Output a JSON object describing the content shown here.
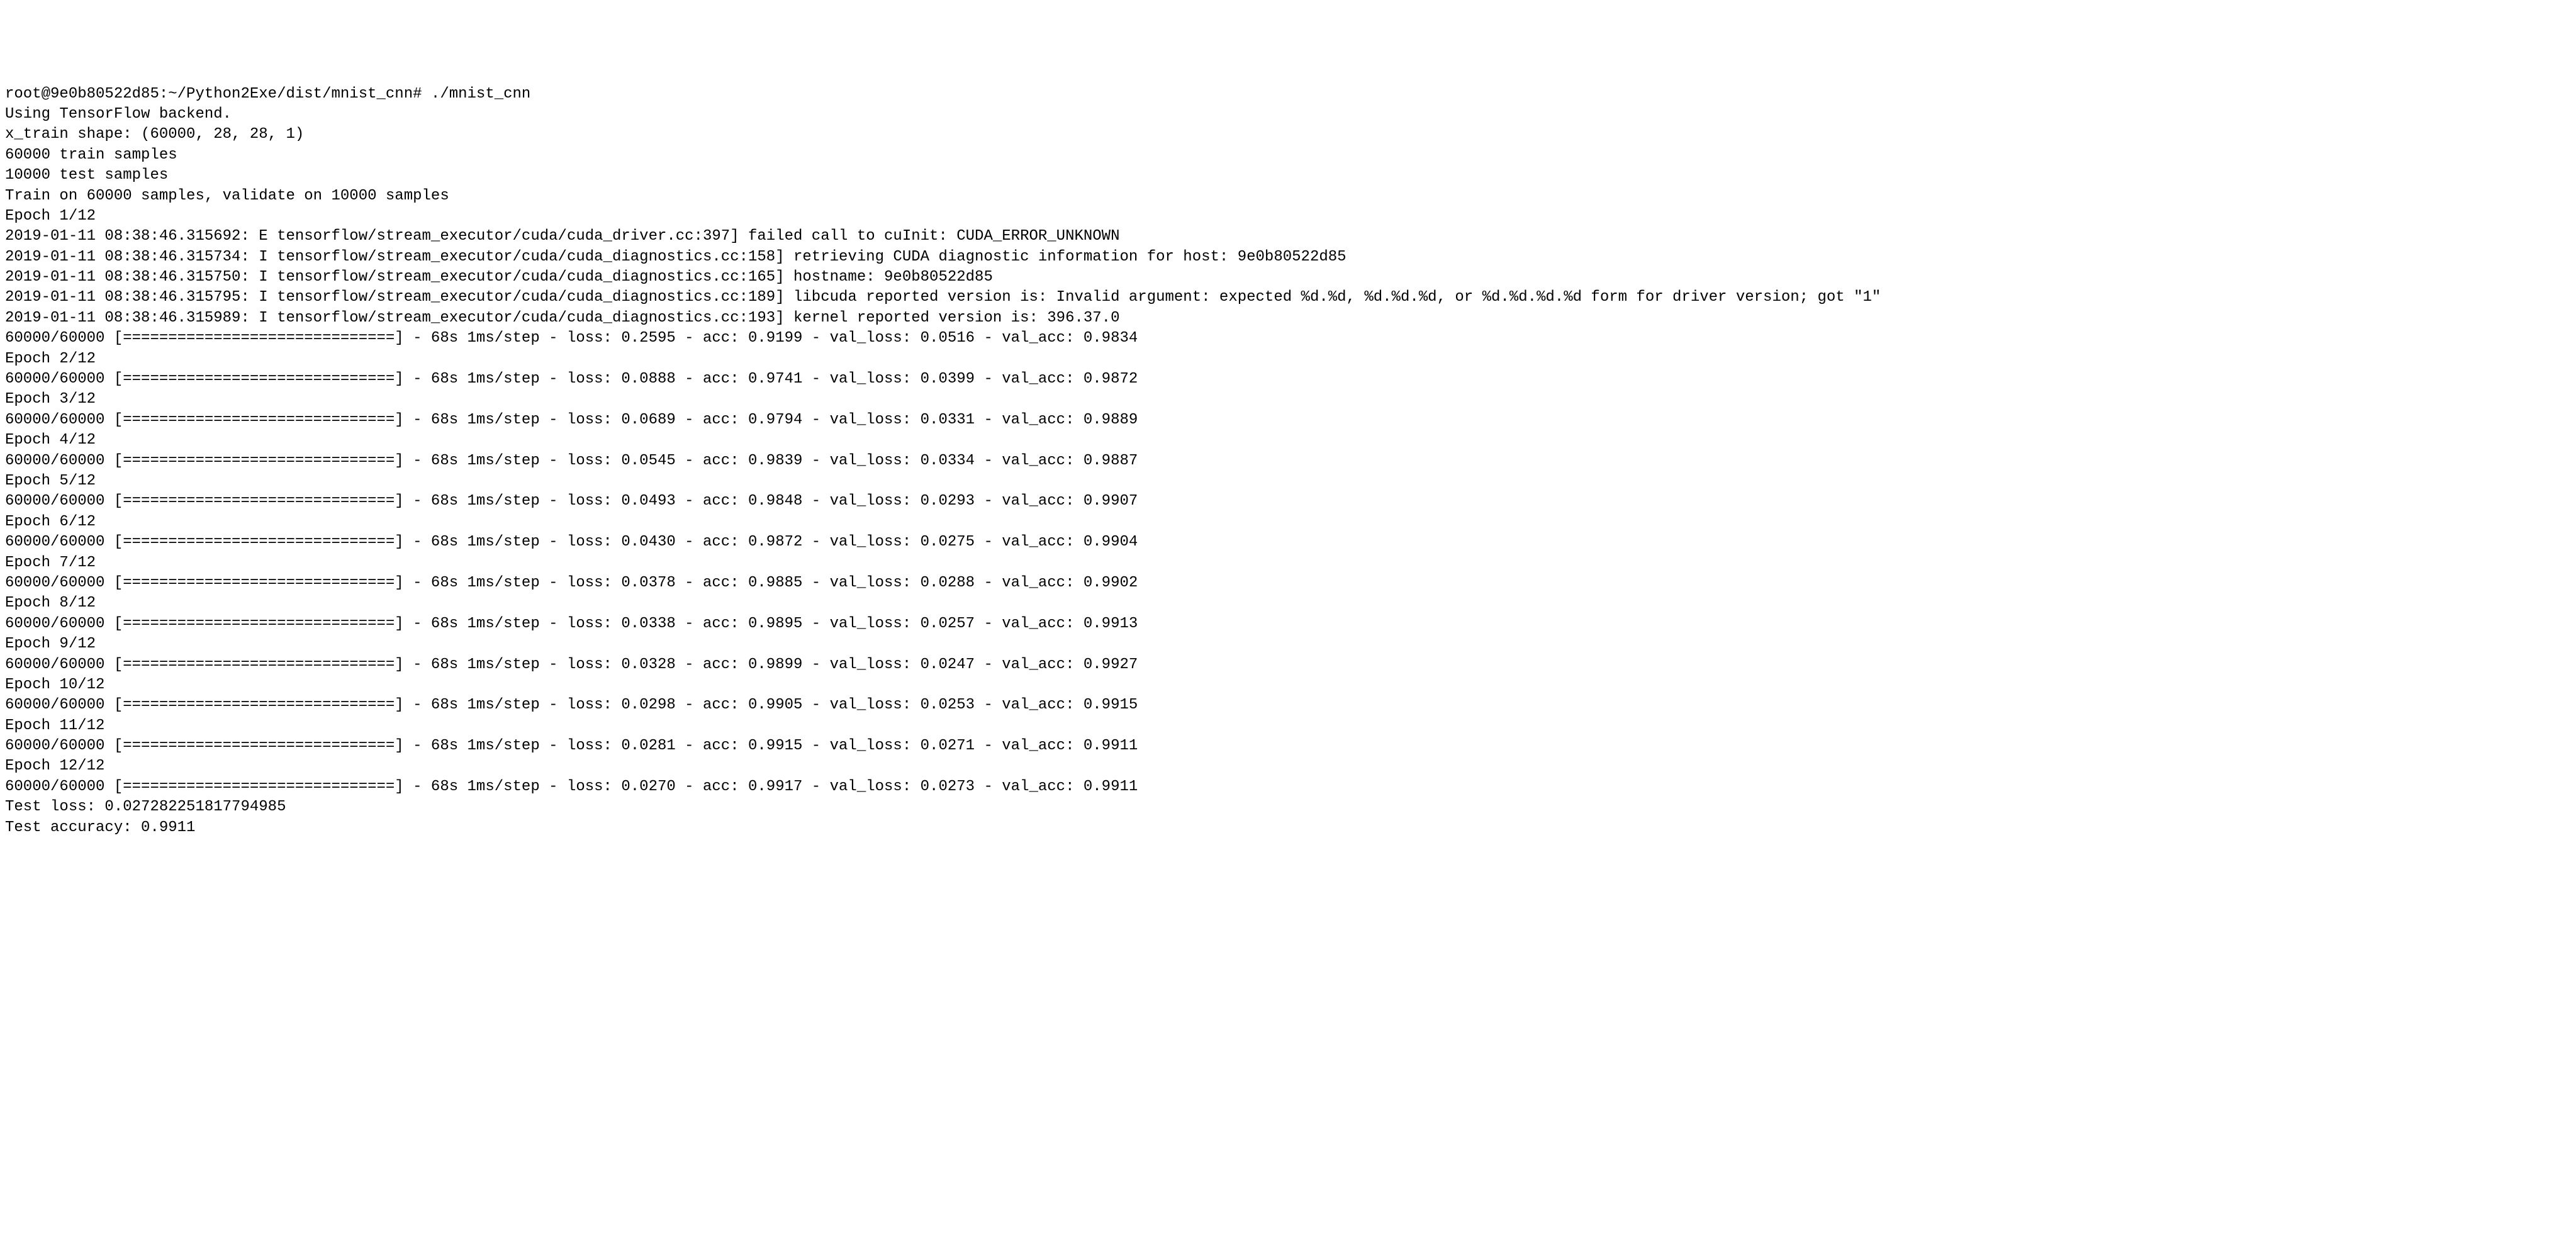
{
  "prompt": "root@9e0b80522d85:~/Python2Exe/dist/mnist_cnn# ./mnist_cnn",
  "header": {
    "backend": "Using TensorFlow backend.",
    "xtrain_shape": "x_train shape: (60000, 28, 28, 1)",
    "train_samples": "60000 train samples",
    "test_samples": "10000 test samples",
    "train_on": "Train on 60000 samples, validate on 10000 samples"
  },
  "epoch1_label": "Epoch 1/12",
  "cuda": {
    "l1": "2019-01-11 08:38:46.315692: E tensorflow/stream_executor/cuda/cuda_driver.cc:397] failed call to cuInit: CUDA_ERROR_UNKNOWN",
    "l2": "2019-01-11 08:38:46.315734: I tensorflow/stream_executor/cuda/cuda_diagnostics.cc:158] retrieving CUDA diagnostic information for host: 9e0b80522d85",
    "l3": "2019-01-11 08:38:46.315750: I tensorflow/stream_executor/cuda/cuda_diagnostics.cc:165] hostname: 9e0b80522d85",
    "l4": "2019-01-11 08:38:46.315795: I tensorflow/stream_executor/cuda/cuda_diagnostics.cc:189] libcuda reported version is: Invalid argument: expected %d.%d, %d.%d.%d, or %d.%d.%d.%d form for driver version; got \"1\"",
    "l5": "2019-01-11 08:38:46.315989: I tensorflow/stream_executor/cuda/cuda_diagnostics.cc:193] kernel reported version is: 396.37.0"
  },
  "epochs": [
    {
      "label": "",
      "progress": "60000/60000 [==============================] - 68s 1ms/step - loss: 0.2595 - acc: 0.9199 - val_loss: 0.0516 - val_acc: 0.9834"
    },
    {
      "label": "Epoch 2/12",
      "progress": "60000/60000 [==============================] - 68s 1ms/step - loss: 0.0888 - acc: 0.9741 - val_loss: 0.0399 - val_acc: 0.9872"
    },
    {
      "label": "Epoch 3/12",
      "progress": "60000/60000 [==============================] - 68s 1ms/step - loss: 0.0689 - acc: 0.9794 - val_loss: 0.0331 - val_acc: 0.9889"
    },
    {
      "label": "Epoch 4/12",
      "progress": "60000/60000 [==============================] - 68s 1ms/step - loss: 0.0545 - acc: 0.9839 - val_loss: 0.0334 - val_acc: 0.9887"
    },
    {
      "label": "Epoch 5/12",
      "progress": "60000/60000 [==============================] - 68s 1ms/step - loss: 0.0493 - acc: 0.9848 - val_loss: 0.0293 - val_acc: 0.9907"
    },
    {
      "label": "Epoch 6/12",
      "progress": "60000/60000 [==============================] - 68s 1ms/step - loss: 0.0430 - acc: 0.9872 - val_loss: 0.0275 - val_acc: 0.9904"
    },
    {
      "label": "Epoch 7/12",
      "progress": "60000/60000 [==============================] - 68s 1ms/step - loss: 0.0378 - acc: 0.9885 - val_loss: 0.0288 - val_acc: 0.9902"
    },
    {
      "label": "Epoch 8/12",
      "progress": "60000/60000 [==============================] - 68s 1ms/step - loss: 0.0338 - acc: 0.9895 - val_loss: 0.0257 - val_acc: 0.9913"
    },
    {
      "label": "Epoch 9/12",
      "progress": "60000/60000 [==============================] - 68s 1ms/step - loss: 0.0328 - acc: 0.9899 - val_loss: 0.0247 - val_acc: 0.9927"
    },
    {
      "label": "Epoch 10/12",
      "progress": "60000/60000 [==============================] - 68s 1ms/step - loss: 0.0298 - acc: 0.9905 - val_loss: 0.0253 - val_acc: 0.9915"
    },
    {
      "label": "Epoch 11/12",
      "progress": "60000/60000 [==============================] - 68s 1ms/step - loss: 0.0281 - acc: 0.9915 - val_loss: 0.0271 - val_acc: 0.9911"
    },
    {
      "label": "Epoch 12/12",
      "progress": "60000/60000 [==============================] - 68s 1ms/step - loss: 0.0270 - acc: 0.9917 - val_loss: 0.0273 - val_acc: 0.9911"
    }
  ],
  "footer": {
    "test_loss": "Test loss: 0.027282251817794985",
    "test_acc": "Test accuracy: 0.9911"
  }
}
